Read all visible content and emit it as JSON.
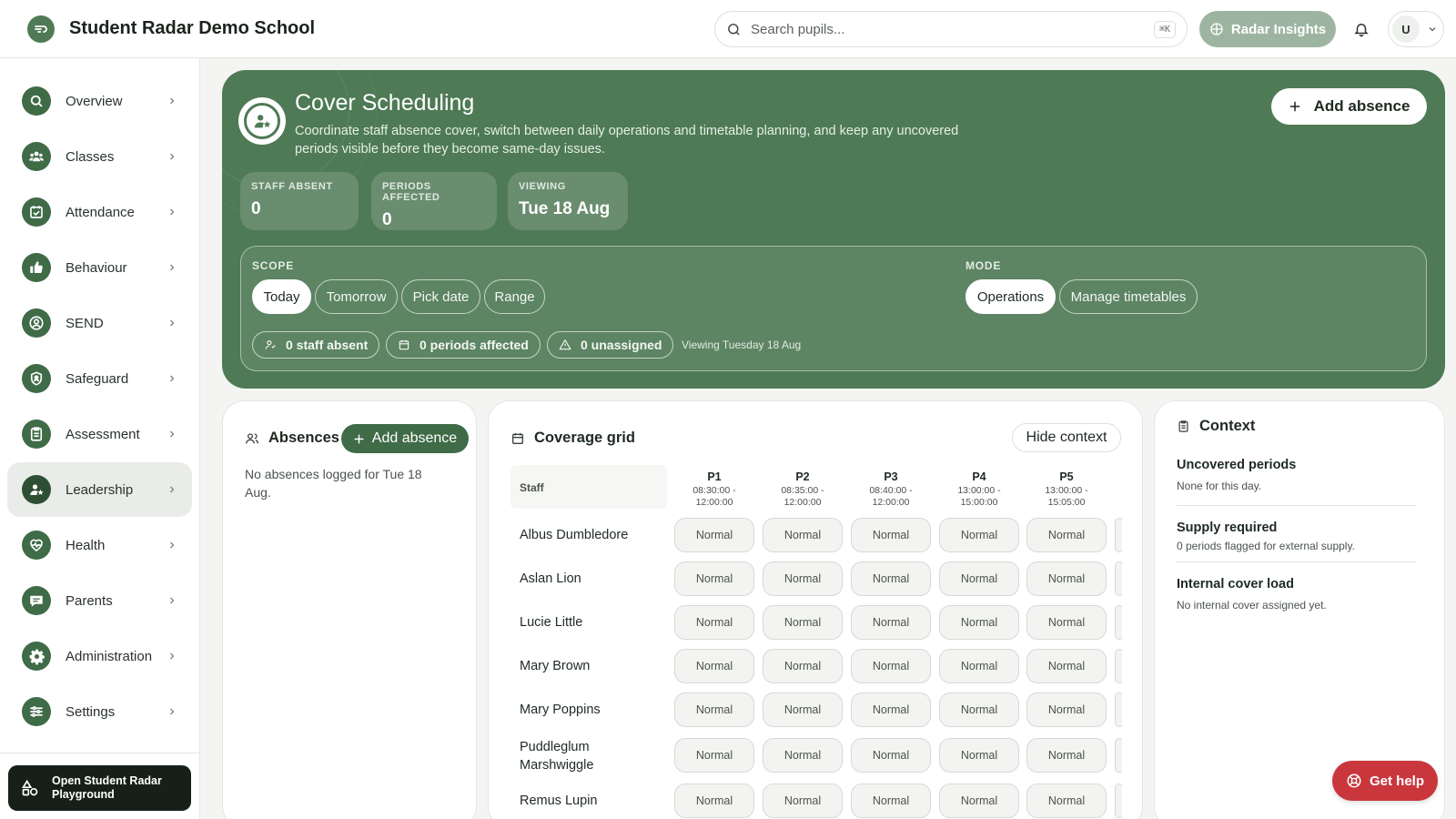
{
  "app": {
    "title": "Student Radar Demo School"
  },
  "search": {
    "placeholder": "Search pupils...",
    "shortcut": "⌘K"
  },
  "header": {
    "insights_label": "Radar Insights",
    "user_initial": "U"
  },
  "sidebar": {
    "items": [
      {
        "label": "Overview",
        "icon": "search-icon"
      },
      {
        "label": "Classes",
        "icon": "users-icon"
      },
      {
        "label": "Attendance",
        "icon": "calendar-check-icon"
      },
      {
        "label": "Behaviour",
        "icon": "thumbs-up-icon"
      },
      {
        "label": "SEND",
        "icon": "user-circle-icon"
      },
      {
        "label": "Safeguard",
        "icon": "shield-icon"
      },
      {
        "label": "Assessment",
        "icon": "clipboard-icon"
      },
      {
        "label": "Leadership",
        "icon": "user-star-icon",
        "active": true
      },
      {
        "label": "Health",
        "icon": "heartbeat-icon"
      },
      {
        "label": "Parents",
        "icon": "chat-icon"
      },
      {
        "label": "Administration",
        "icon": "gear-icon"
      },
      {
        "label": "Settings",
        "icon": "sliders-icon"
      }
    ],
    "playground_label": "Open Student Radar Playground"
  },
  "hero": {
    "title": "Cover Scheduling",
    "description": "Coordinate staff absence cover, switch between daily operations and timetable planning, and keep any uncovered periods visible before they become same-day issues.",
    "add_absence_label": "Add absence",
    "stats": [
      {
        "label": "STAFF ABSENT",
        "value": "0"
      },
      {
        "label": "PERIODS AFFECTED",
        "value": "0"
      },
      {
        "label": "VIEWING",
        "value": "Tue 18 Aug"
      }
    ],
    "scope_label": "SCOPE",
    "scope_options": [
      "Today",
      "Tomorrow",
      "Pick date",
      "Range"
    ],
    "scope_selected": "Today",
    "mode_label": "MODE",
    "mode_options": [
      "Operations",
      "Manage timetables"
    ],
    "mode_selected": "Operations",
    "chips": [
      "0 staff absent",
      "0 periods affected",
      "0 unassigned"
    ],
    "viewing_note": "Viewing Tuesday 18 Aug"
  },
  "absences": {
    "title": "Absences",
    "add_label": "Add absence",
    "empty_text": "No absences logged for Tue 18 Aug."
  },
  "grid": {
    "title": "Coverage grid",
    "hide_context_label": "Hide context",
    "staff_header": "Staff",
    "periods": [
      {
        "name": "P1",
        "time": "08:30:00 - 12:00:00"
      },
      {
        "name": "P2",
        "time": "08:35:00 - 12:00:00"
      },
      {
        "name": "P3",
        "time": "08:40:00 - 12:00:00"
      },
      {
        "name": "P4",
        "time": "13:00:00 - 15:00:00"
      },
      {
        "name": "P5",
        "time": "13:00:00 - 15:05:00"
      }
    ],
    "cell_label": "Normal",
    "staff": [
      "Albus Dumbledore",
      "Aslan Lion",
      "Lucie Little",
      "Mary Brown",
      "Mary Poppins",
      "Puddleglum Marshwiggle",
      "Remus Lupin"
    ]
  },
  "context": {
    "title": "Context",
    "sections": [
      {
        "heading": "Uncovered periods",
        "text": "None for this day."
      },
      {
        "heading": "Supply required",
        "text": "0 periods flagged for external supply."
      },
      {
        "heading": "Internal cover load",
        "text": "No internal cover assigned yet."
      }
    ]
  },
  "help": {
    "label": "Get help"
  },
  "colors": {
    "brand": "#4e7a55",
    "brand_dark": "#3f6b47",
    "help": "#c9373d"
  }
}
